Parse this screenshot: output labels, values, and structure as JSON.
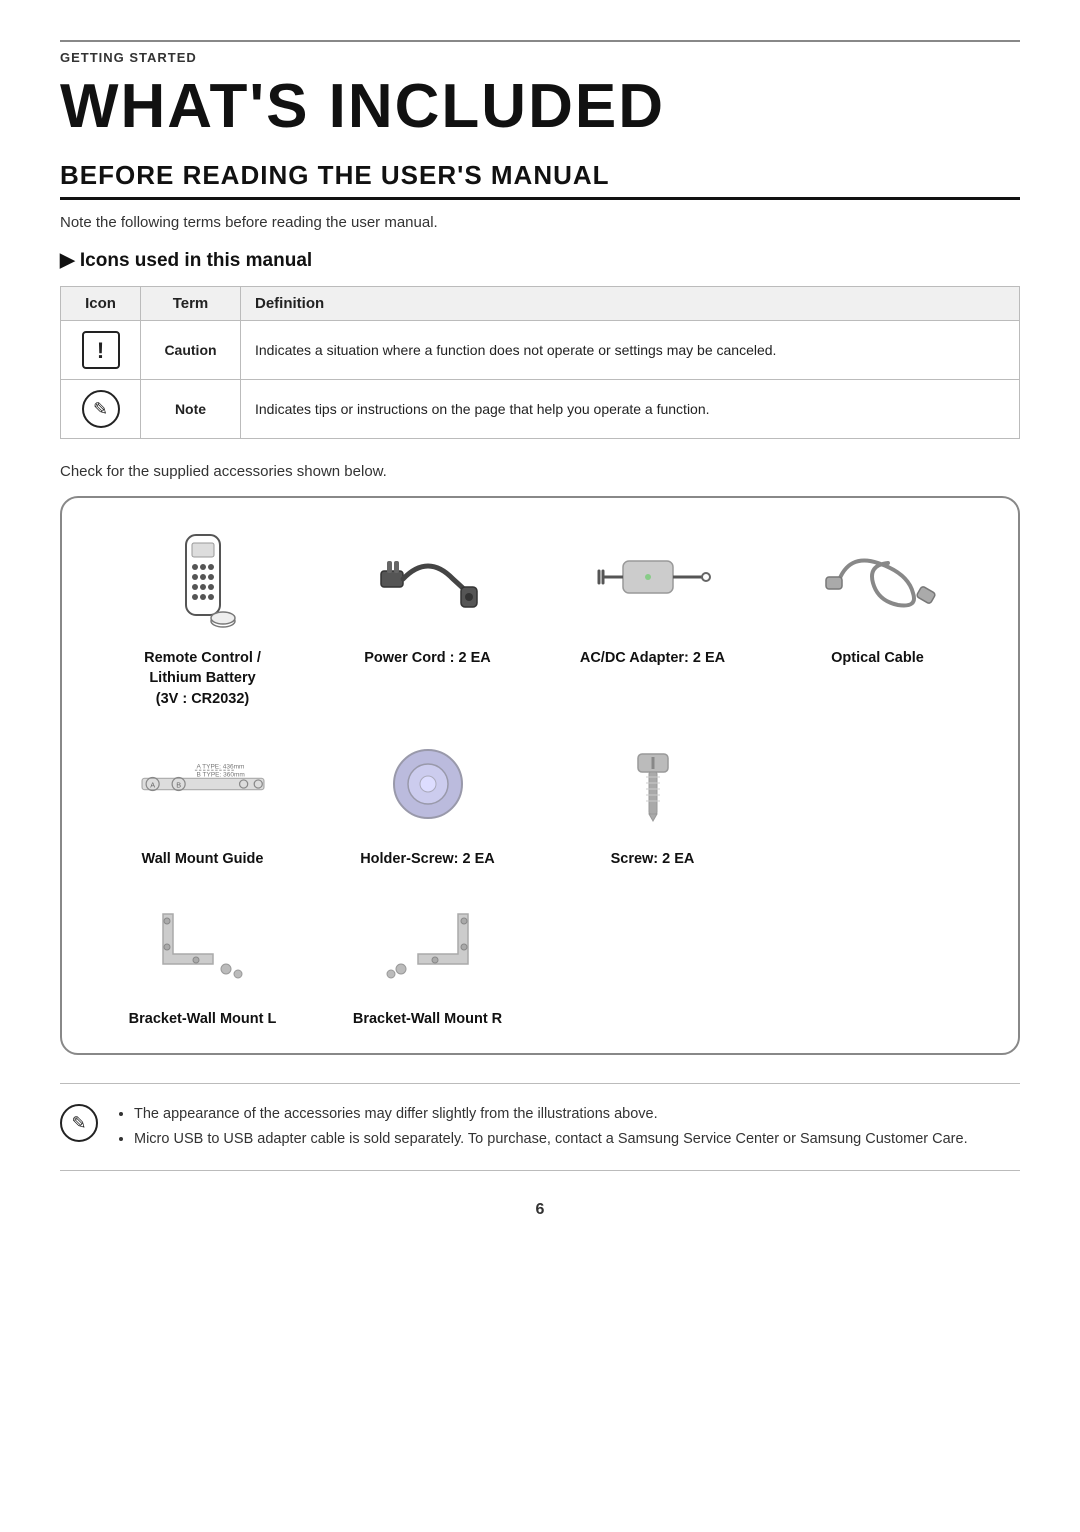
{
  "section": "GETTING STARTED",
  "page_title": "WHAT'S INCLUDED",
  "before_reading": {
    "title": "BEFORE READING THE USER'S MANUAL",
    "note": "Note the following terms before reading the user manual.",
    "icons_section_title": "▶ Icons used in this manual",
    "table": {
      "headers": [
        "Icon",
        "Term",
        "Definition"
      ],
      "rows": [
        {
          "icon_type": "caution",
          "icon_symbol": "!",
          "term": "Caution",
          "definition": "Indicates a situation where a function does not operate or settings may be canceled."
        },
        {
          "icon_type": "note",
          "icon_symbol": "✎",
          "term": "Note",
          "definition": "Indicates tips or instructions on the page that help you operate a function."
        }
      ]
    }
  },
  "accessories": {
    "check_label": "Check for the supplied accessories shown below.",
    "items_row1": [
      {
        "id": "remote-control",
        "label": "Remote Control /\nLithium Battery\n(3V : CR2032)"
      },
      {
        "id": "power-cord",
        "label": "Power Cord : 2 EA"
      },
      {
        "id": "ac-adapter",
        "label": "AC/DC Adapter: 2 EA"
      },
      {
        "id": "optical-cable",
        "label": "Optical Cable"
      }
    ],
    "items_row2": [
      {
        "id": "wall-mount-guide",
        "label": "Wall Mount Guide"
      },
      {
        "id": "holder-screw",
        "label": "Holder-Screw: 2 EA"
      },
      {
        "id": "screw",
        "label": "Screw: 2 EA"
      }
    ],
    "items_row3": [
      {
        "id": "bracket-wall-mount-l",
        "label": "Bracket-Wall Mount L"
      },
      {
        "id": "bracket-wall-mount-r",
        "label": "Bracket-Wall Mount R"
      }
    ]
  },
  "note_section": {
    "bullets": [
      "The appearance of the accessories may differ slightly from the illustrations above.",
      "Micro USB to USB adapter cable is sold separately. To purchase, contact a Samsung Service Center or Samsung Customer Care."
    ]
  },
  "page_number": "6"
}
